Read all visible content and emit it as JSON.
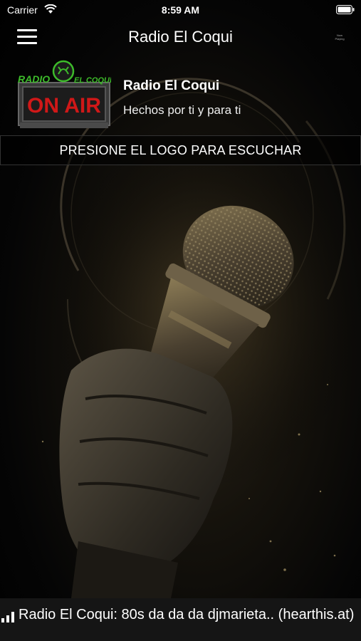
{
  "status_bar": {
    "carrier": "Carrier",
    "time": "8:59 AM"
  },
  "nav": {
    "title": "Radio El Coqui",
    "now_playing": "Now Playing"
  },
  "station": {
    "logo_top_text": "RADIO",
    "logo_right_text": "EL COQUI",
    "logo_sign_text": "ON AIR",
    "name": "Radio El Coqui",
    "slogan": "Hechos por ti y para ti"
  },
  "listen_prompt": "PRESIONE EL LOGO PARA ESCUCHAR",
  "ticker": {
    "text": "Radio El Coqui: 80s da da da djmarieta.. (hearthis.at)"
  },
  "colors": {
    "background": "#000000",
    "logo_green": "#3dbb2a",
    "on_air_red": "#d01818",
    "ticker_bg": "#151515"
  },
  "icons": [
    "wifi-icon",
    "battery-icon",
    "menu-icon",
    "signal-bars-icon"
  ]
}
